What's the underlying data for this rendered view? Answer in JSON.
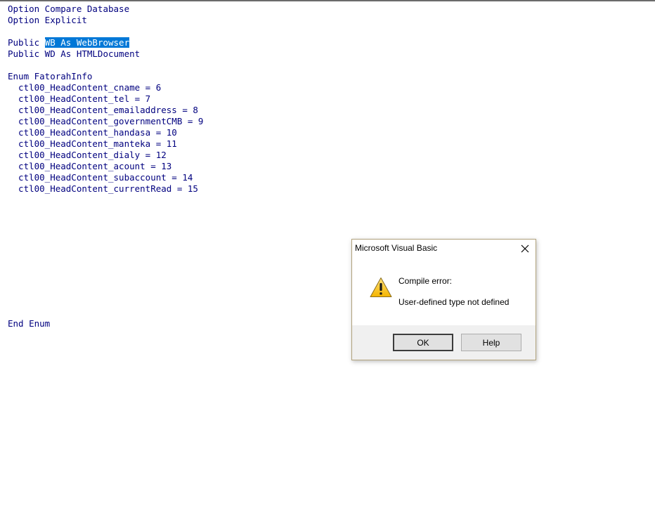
{
  "editor": {
    "lines": [
      "Option Compare Database",
      "Option Explicit",
      "",
      {
        "prefix": "Public ",
        "selected": "WB As WebBrowser"
      },
      "Public WD As HTMLDocument",
      "",
      "Enum FatorahInfo",
      "  ctl00_HeadContent_cname = 6",
      "  ctl00_HeadContent_tel = 7",
      "  ctl00_HeadContent_emailaddress = 8",
      "  ctl00_HeadContent_governmentCMB = 9",
      "  ctl00_HeadContent_handasa = 10",
      "  ctl00_HeadContent_manteka = 11",
      "  ctl00_HeadContent_dialy = 12",
      "  ctl00_HeadContent_acount = 13",
      "  ctl00_HeadContent_subaccount = 14",
      "  ctl00_HeadContent_currentRead = 15"
    ],
    "end_line": "End Enum",
    "code_color": "#00007f",
    "selection_color": "#0078d7"
  },
  "dialog": {
    "title": "Microsoft Visual Basic",
    "icon": "warning-icon",
    "heading": "Compile error:",
    "message": "User-defined type not defined",
    "ok_label": "OK",
    "help_label": "Help"
  }
}
